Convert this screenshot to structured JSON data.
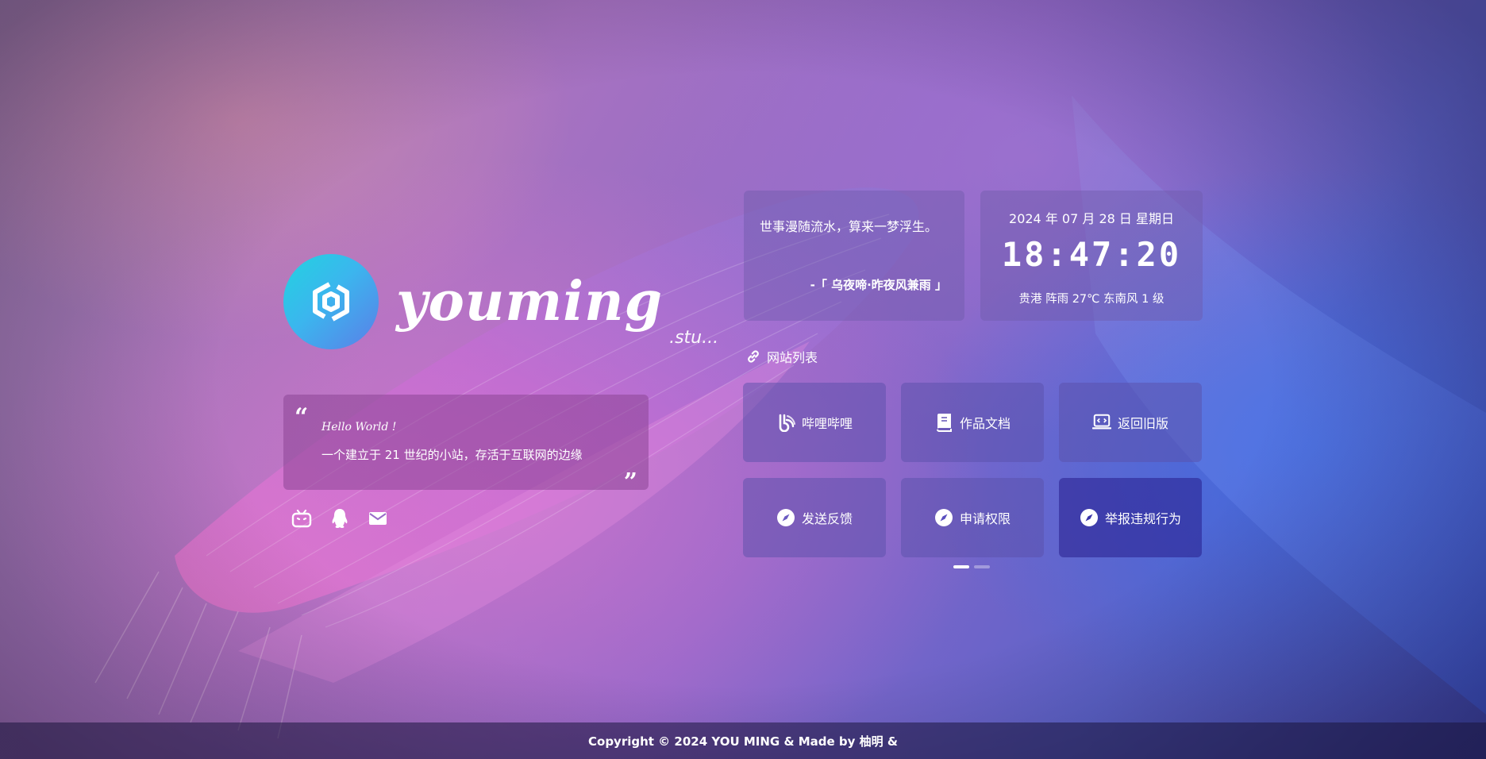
{
  "brand": {
    "name": "youming",
    "suffix": ".stu..."
  },
  "intro": {
    "hello": "Hello World !",
    "description": "一个建立于 21 世纪的小站，存活于互联网的边缘"
  },
  "social": [
    "bilibili-icon",
    "qq-icon",
    "mail-icon"
  ],
  "poem": {
    "text": "世事漫随流水，算来一梦浮生。",
    "source": "-「 乌夜啼·昨夜风兼雨 」"
  },
  "time": {
    "date": "2024 年 07 月 28 日 星期日",
    "clock": "18:47:20",
    "weather": "贵港 阵雨 27℃ 东南风 1 级"
  },
  "sites": {
    "title": "网站列表",
    "items": [
      {
        "label": "哔哩哔哩",
        "icon": "bilibili-logo-icon"
      },
      {
        "label": "作品文档",
        "icon": "book-icon"
      },
      {
        "label": "返回旧版",
        "icon": "monitor-code-icon"
      },
      {
        "label": "发送反馈",
        "icon": "compass-icon"
      },
      {
        "label": "申请权限",
        "icon": "compass-icon"
      },
      {
        "label": "举报违规行为",
        "icon": "compass-icon"
      }
    ]
  },
  "footer": {
    "text": "Copyright  © 2024 YOU MING & Made by 柚明 &"
  }
}
